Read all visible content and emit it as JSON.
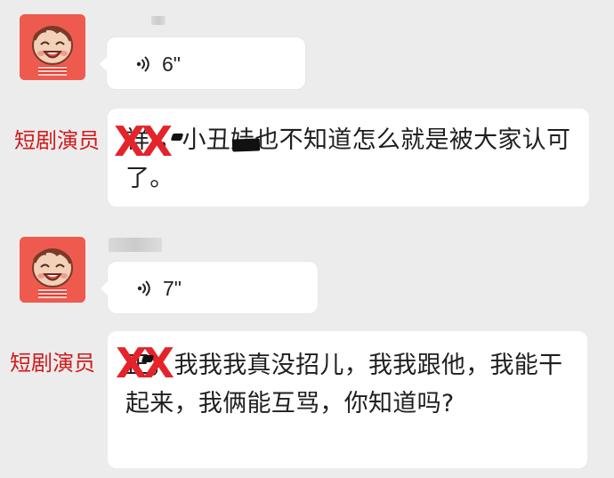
{
  "messages": [
    {
      "type": "voice",
      "duration": "6\"",
      "transcript": "祥 ，小丑娃也不知道怎么就是被大家认可了。",
      "overlay_label": "短剧演员",
      "overlay_mark": "XX"
    },
    {
      "type": "voice",
      "duration": "7\"",
      "transcript": "正，我我我真没招儿，我我跟他，我能干起来，我俩能互骂，你知道吗?",
      "overlay_label": "短剧演员",
      "overlay_mark": "XX"
    }
  ],
  "icons": {
    "voice_wave": "voice-wave-icon",
    "avatar": "cartoon-child-avatar"
  },
  "colors": {
    "background": "#ececec",
    "bubble": "#ffffff",
    "avatar": "#ef5a4f",
    "label": "#d11a1a",
    "mark": "#e4232b"
  }
}
